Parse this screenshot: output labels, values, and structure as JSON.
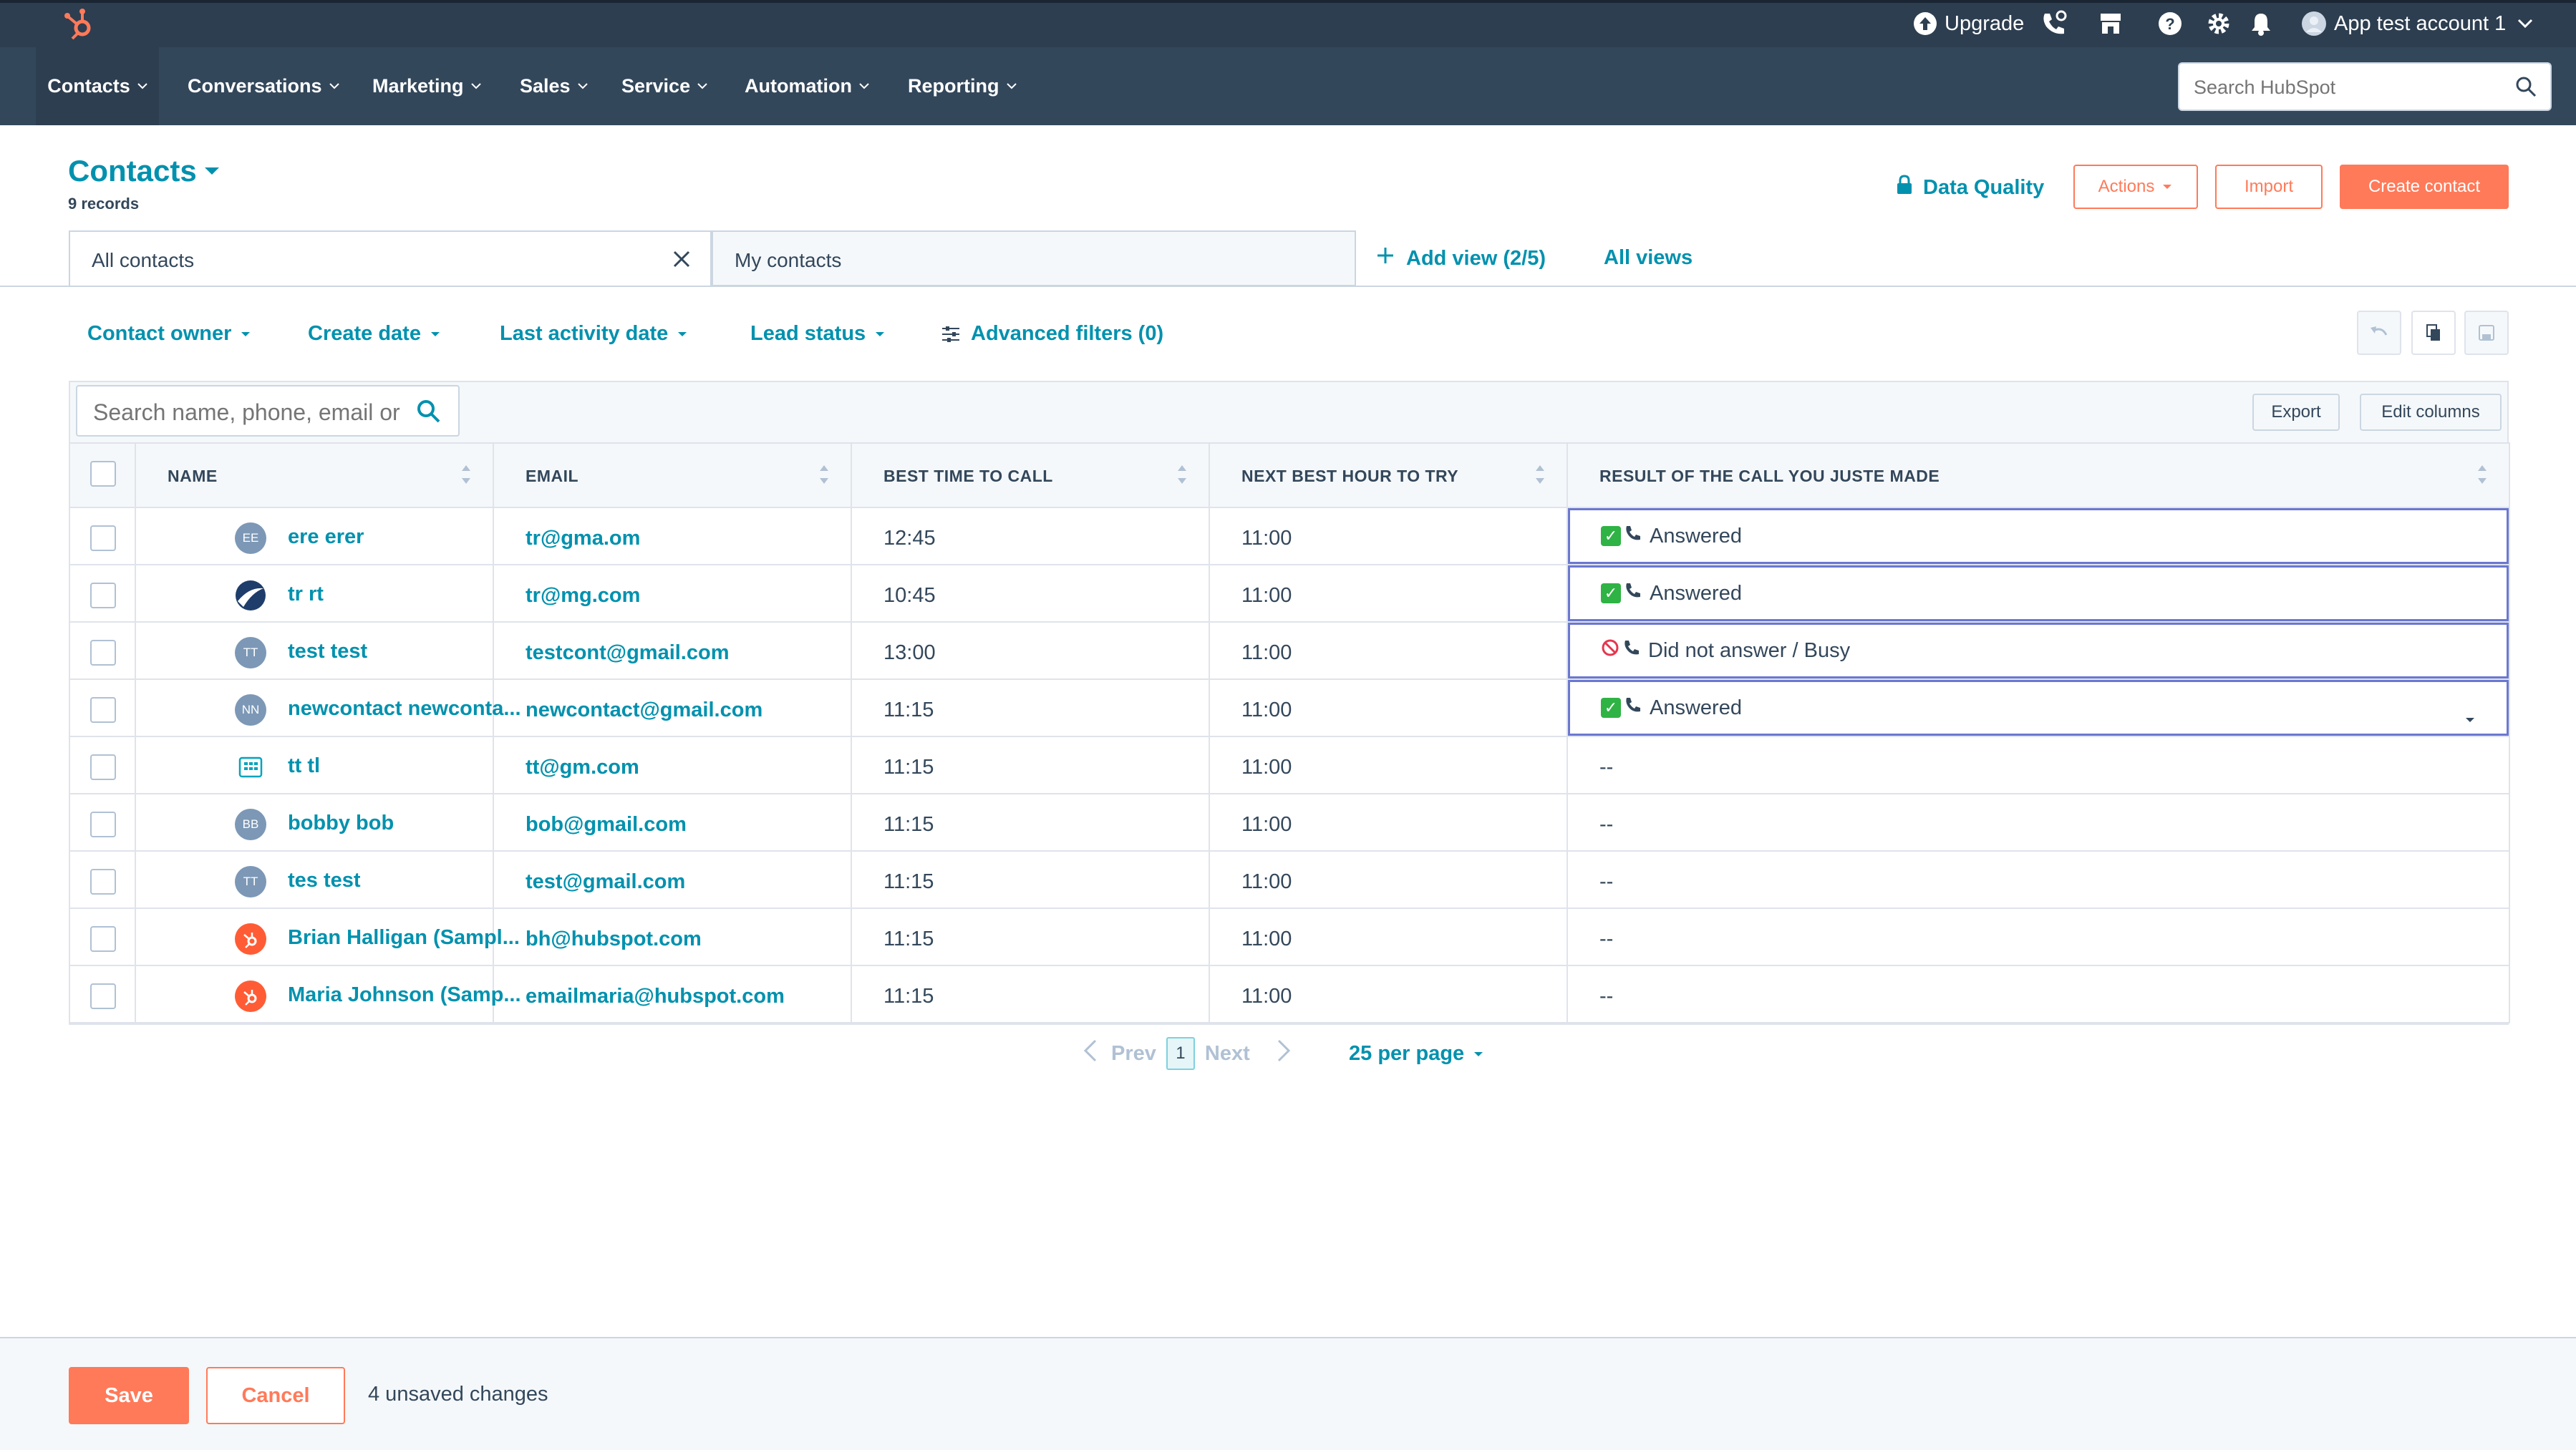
{
  "topbar": {
    "upgrade_label": "Upgrade",
    "account_label": "App test account 1",
    "icons": [
      "hubspot-logo-icon",
      "upgrade-icon",
      "calling-icon",
      "marketplace-icon",
      "help-icon",
      "settings-icon",
      "notifications-icon",
      "account-avatar-icon"
    ]
  },
  "nav": {
    "items": [
      "Contacts",
      "Conversations",
      "Marketing",
      "Sales",
      "Service",
      "Automation",
      "Reporting"
    ],
    "search_placeholder": "Search HubSpot"
  },
  "header": {
    "title": "Contacts",
    "records": "9 records",
    "data_quality": "Data Quality",
    "actions": "Actions",
    "import": "Import",
    "create_contact": "Create contact"
  },
  "views": {
    "tab_all": "All contacts",
    "tab_mine": "My contacts",
    "add_view": "Add view (2/5)",
    "all_views": "All views"
  },
  "filters": {
    "contact_owner": "Contact owner",
    "create_date": "Create date",
    "last_activity": "Last activity date",
    "lead_status": "Lead status",
    "advanced": "Advanced filters (0)"
  },
  "table": {
    "search_placeholder": "Search name, phone, email or",
    "export": "Export",
    "edit_columns": "Edit columns",
    "columns": [
      "NAME",
      "EMAIL",
      "BEST TIME TO CALL",
      "NEXT BEST HOUR TO TRY",
      "RESULT OF THE CALL YOU JUSTE MADE"
    ],
    "rows": [
      {
        "initials": "EE",
        "avatar": "initials",
        "name": "ere erer",
        "email": "tr@gma.om",
        "best_time": "12:45",
        "next_hour": "11:00",
        "result": "Answered",
        "result_status": "answered",
        "edited": true
      },
      {
        "initials": "",
        "avatar": "logo",
        "name": "tr rt",
        "email": "tr@mg.com",
        "best_time": "10:45",
        "next_hour": "11:00",
        "result": "Answered",
        "result_status": "answered",
        "edited": true
      },
      {
        "initials": "TT",
        "avatar": "initials",
        "name": "test test",
        "email": "testcont@gmail.com",
        "best_time": "13:00",
        "next_hour": "11:00",
        "result": "Did not answer / Busy",
        "result_status": "busy",
        "edited": true
      },
      {
        "initials": "NN",
        "avatar": "initials",
        "name": "newcontact newconta...",
        "email": "newcontact@gmail.com",
        "best_time": "11:15",
        "next_hour": "11:00",
        "result": "Answered",
        "result_status": "answered",
        "edited": true,
        "dropdown": true
      },
      {
        "initials": "",
        "avatar": "company",
        "name": "tt tl",
        "email": "tt@gm.com",
        "best_time": "11:15",
        "next_hour": "11:00",
        "result": "--",
        "result_status": "empty",
        "edited": false
      },
      {
        "initials": "BB",
        "avatar": "initials",
        "name": "bobby bob",
        "email": "bob@gmail.com",
        "best_time": "11:15",
        "next_hour": "11:00",
        "result": "--",
        "result_status": "empty",
        "edited": false
      },
      {
        "initials": "TT",
        "avatar": "initials",
        "name": "tes test",
        "email": "test@gmail.com",
        "best_time": "11:15",
        "next_hour": "11:00",
        "result": "--",
        "result_status": "empty",
        "edited": false
      },
      {
        "initials": "",
        "avatar": "hubspot",
        "name": "Brian Halligan (Sampl...",
        "email": "bh@hubspot.com",
        "best_time": "11:15",
        "next_hour": "11:00",
        "result": "--",
        "result_status": "empty",
        "edited": false
      },
      {
        "initials": "",
        "avatar": "hubspot",
        "name": "Maria Johnson (Samp...",
        "email": "emailmaria@hubspot.com",
        "best_time": "11:15",
        "next_hour": "11:00",
        "result": "--",
        "result_status": "empty",
        "edited": false
      }
    ]
  },
  "pagination": {
    "prev": "Prev",
    "current": "1",
    "next": "Next",
    "per_page": "25 per page"
  },
  "footer": {
    "save": "Save",
    "cancel": "Cancel",
    "unsaved": "4 unsaved changes"
  },
  "colors": {
    "nav_bg": "#33475b",
    "link": "#0091ae",
    "accent": "#ff7a59",
    "edited_outline": "#6a78d1",
    "answered_green": "#2fb344"
  }
}
